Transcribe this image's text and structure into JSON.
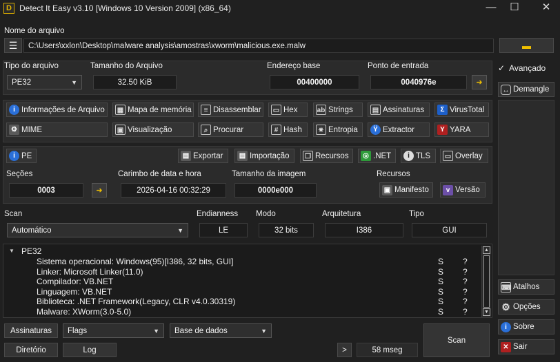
{
  "window": {
    "title": "Detect It Easy v3.10 [Windows 10 Version 2009] (x86_64)",
    "logo_letter": "D",
    "minimize": "—",
    "maximize": "☐",
    "close": "✕"
  },
  "file": {
    "label": "Nome do arquivo",
    "path": "C:\\Users\\xxlon\\Desktop\\malware analysis\\amostras\\xworm\\malicious.exe.malw"
  },
  "info": {
    "file_type_label": "Tipo do arquivo",
    "file_type_value": "PE32",
    "file_size_label": "Tamanho do Arquivo",
    "file_size_value": "32.50 KiB",
    "base_address_label": "Endereço base",
    "base_address_value": "00400000",
    "entry_point_label": "Ponto de entrada",
    "entry_point_value": "0040976e",
    "arrow": "➜"
  },
  "tools_row1": [
    {
      "label": "Informações de Arquivo",
      "icon": "i"
    },
    {
      "label": "Mapa de memória",
      "icon": "▦"
    },
    {
      "label": "Disassemblar",
      "icon": "≡"
    },
    {
      "label": "Hex",
      "icon": "▭"
    },
    {
      "label": "Strings",
      "icon": "ab"
    },
    {
      "label": "Assinaturas",
      "icon": "▤"
    },
    {
      "label": "VirusTotal",
      "icon": "Σ"
    }
  ],
  "tools_row2": [
    {
      "label": "MIME",
      "icon": "⚙"
    },
    {
      "label": "Visualização",
      "icon": "▣"
    },
    {
      "label": "Procurar",
      "icon": "⌕"
    },
    {
      "label": "Hash",
      "icon": "#"
    },
    {
      "label": "Entropia",
      "icon": "✷"
    },
    {
      "label": "Extractor",
      "icon": "Ÿ"
    },
    {
      "label": "YARA",
      "icon": "Y"
    }
  ],
  "pe": {
    "pe_label": "PE",
    "export_label": "Exportar",
    "import_label": "Importação",
    "resources_btn_label": "Recursos",
    "net_label": ".NET",
    "tls_label": "TLS",
    "overlay_label": "Overlay",
    "sections_label": "Seções",
    "sections_value": "0003",
    "timestamp_label": "Carimbo de data e hora",
    "timestamp_value": "2026-04-16 00:32:29",
    "image_size_label": "Tamanho da imagem",
    "image_size_value": "0000e000",
    "resources_label": "Recursos",
    "manifest_label": "Manifesto",
    "version_label": "Versão"
  },
  "scan": {
    "scan_label": "Scan",
    "scan_value": "Automático",
    "endianness_label": "Endianness",
    "endianness_value": "LE",
    "mode_label": "Modo",
    "mode_value": "32 bits",
    "arch_label": "Arquitetura",
    "arch_value": "I386",
    "type_label": "Tipo",
    "type_value": "GUI"
  },
  "results": {
    "root": "PE32",
    "rows": [
      {
        "text": "Sistema operacional: Windows(95)[I386, 32 bits, GUI]",
        "s": "S",
        "q": "?"
      },
      {
        "text": "Linker: Microsoft Linker(11.0)",
        "s": "S",
        "q": "?"
      },
      {
        "text": "Compilador: VB.NET",
        "s": "S",
        "q": "?"
      },
      {
        "text": "Linguagem: VB.NET",
        "s": "S",
        "q": "?"
      },
      {
        "text": "Biblioteca: .NET Framework(Legacy, CLR v4.0.30319)",
        "s": "S",
        "q": "?"
      },
      {
        "text": "Malware: XWorm(3.0-5.0)",
        "s": "S",
        "q": "?"
      }
    ]
  },
  "bottom": {
    "signatures_label": "Assinaturas",
    "flags_label": "Flags",
    "database_label": "Base de dados",
    "directory_label": "Diretório",
    "log_label": "Log",
    "next_label": ">",
    "time_value": "58 mseg",
    "scan_btn_label": "Scan"
  },
  "side": {
    "advanced_label": "Avançado",
    "advanced_check": "✓",
    "demangle_label": "Demangle",
    "shortcuts_label": "Atalhos",
    "options_label": "Opções",
    "about_label": "Sobre",
    "exit_label": "Sair"
  },
  "colors": {
    "background": "#202020",
    "panel": "#2b2b2b",
    "accent_yellow": "#f0c000",
    "info_blue": "#2a6fd8"
  }
}
